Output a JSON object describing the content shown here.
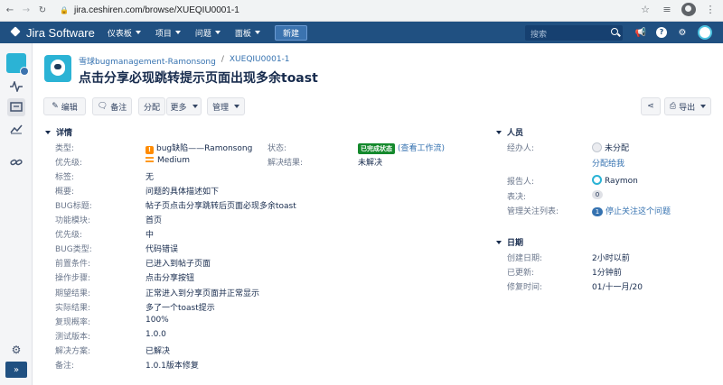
{
  "browser": {
    "url": "jira.ceshiren.com/browse/XUEQIU0001-1"
  },
  "header": {
    "product": "Jira Software",
    "menu": [
      "仪表板",
      "项目",
      "问题",
      "面板"
    ],
    "create_label": "新建",
    "search_placeholder": "搜索"
  },
  "breadcrumb": {
    "project": "雪球bugmanagement-Ramonsong",
    "issue_key": "XUEQIU0001-1"
  },
  "issue_title": "点击分享必现跳转提示页面出现多余toast",
  "toolbar": {
    "edit": "编辑",
    "comment": "备注",
    "assign": "分配",
    "more": "更多",
    "admin": "管理",
    "export": "导出"
  },
  "details": {
    "heading": "详情",
    "fields": [
      {
        "label": "类型:",
        "value": "bug缺陷——Ramonsong"
      },
      {
        "label": "优先级:",
        "value": "Medium"
      },
      {
        "label": "标签:",
        "value": "无"
      },
      {
        "label": "概要:",
        "value": "问题的具体描述如下"
      },
      {
        "label": "BUG标题:",
        "value": "帖子页点击分享跳转后页面必现多余toast"
      },
      {
        "label": "功能模块:",
        "value": "首页"
      },
      {
        "label": "优先级:",
        "value": "中"
      },
      {
        "label": "BUG类型:",
        "value": "代码错误"
      },
      {
        "label": "前置条件:",
        "value": "已进入到帖子页面"
      },
      {
        "label": "操作步骤:",
        "value": "点击分享按钮"
      },
      {
        "label": "期望结果:",
        "value": "正常进入到分享页面并正常显示"
      },
      {
        "label": "实际结果:",
        "value": "多了一个toast提示"
      },
      {
        "label": "复现概率:",
        "value": "100%"
      },
      {
        "label": "测试版本:",
        "value": "1.0.0"
      },
      {
        "label": "解决方案:",
        "value": "已解决"
      },
      {
        "label": "备注:",
        "value": "1.0.1版本修复"
      }
    ],
    "status_label": "状态:",
    "status_value": "已完成状态",
    "workflow_link": "(查看工作流)",
    "resolution_label": "解决结果:",
    "resolution_value": "未解决"
  },
  "people": {
    "heading": "人员",
    "assignee_label": "经办人:",
    "assignee_value": "未分配",
    "assign_to_me": "分配给我",
    "reporter_label": "报告人:",
    "reporter_value": "Raymon",
    "votes_label": "表决:",
    "votes_count": "0",
    "watchers_label": "管理关注列表:",
    "watchers_count": "1",
    "watch_action": "停止关注这个问题"
  },
  "dates": {
    "heading": "日期",
    "created_label": "创建日期:",
    "created_value": "2小时以前",
    "updated_label": "已更新:",
    "updated_value": "1分钟前",
    "repair_label": "修复时间:",
    "repair_value": "01/十一月/20"
  },
  "colors": {
    "header_bg": "#205081",
    "link": "#3572b0",
    "status_done": "#14892c"
  }
}
